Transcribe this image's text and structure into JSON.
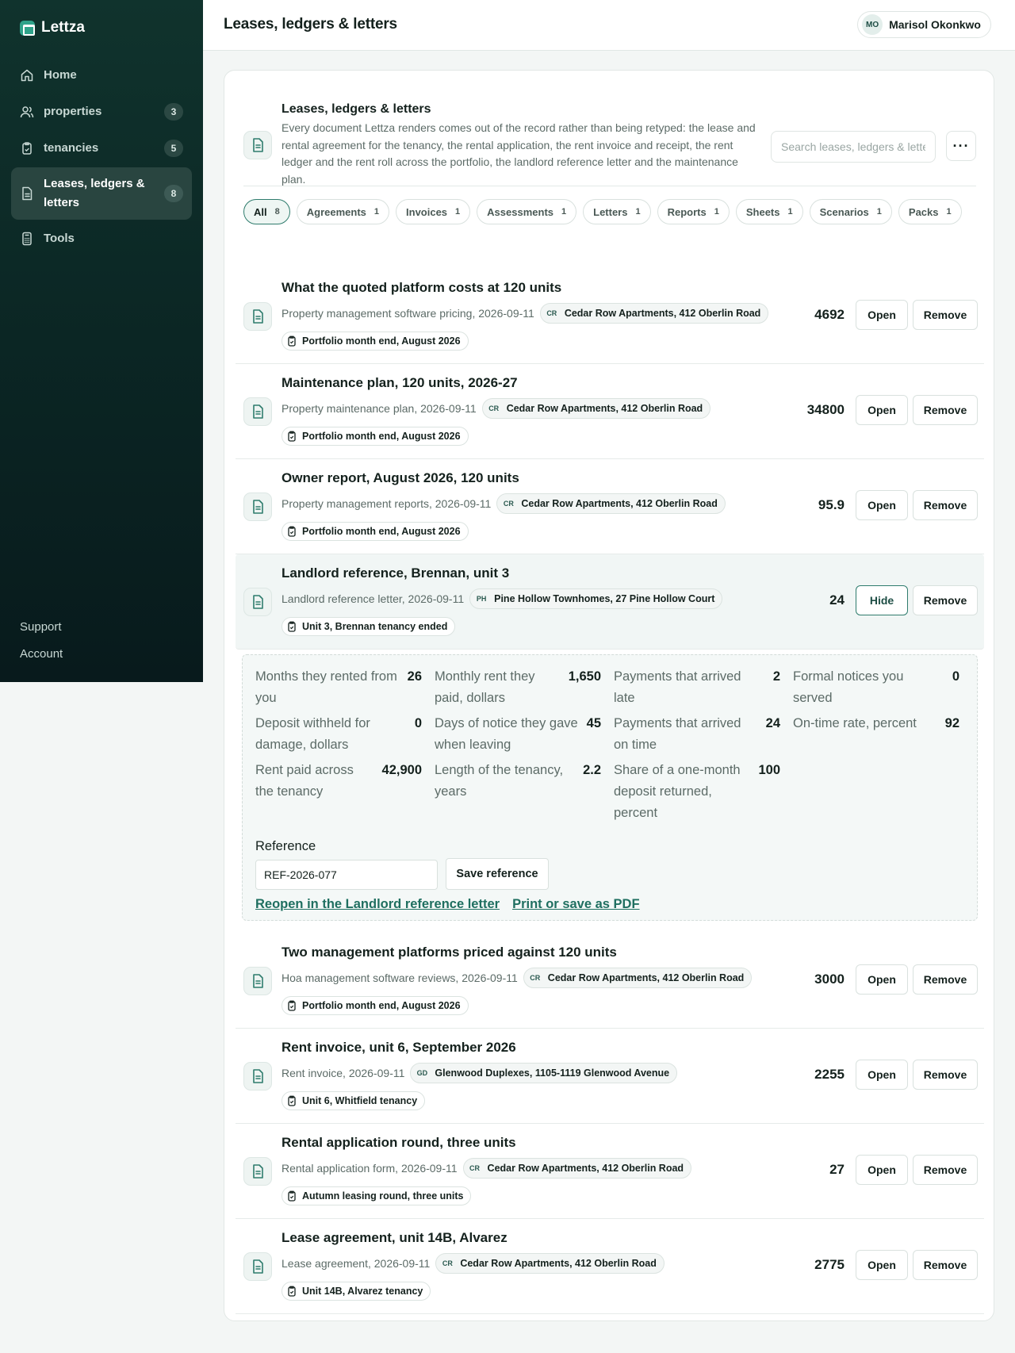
{
  "app": {
    "name": "Lettza"
  },
  "sidebar": {
    "items": [
      {
        "label": "Home",
        "icon": "home-icon",
        "count": null
      },
      {
        "label": "properties",
        "icon": "users-icon",
        "count": "3"
      },
      {
        "label": "tenancies",
        "icon": "clipboard-icon",
        "count": "5"
      },
      {
        "label": "Leases, ledgers & letters",
        "icon": "document-icon",
        "count": "8",
        "active": true
      },
      {
        "label": "Tools",
        "icon": "calculator-icon",
        "count": null
      }
    ],
    "footer": [
      "Support",
      "Account"
    ]
  },
  "header": {
    "title": "Leases, ledgers & letters",
    "user": {
      "initials": "MO",
      "name": "Marisol Okonkwo"
    }
  },
  "intro": {
    "title": "Leases, ledgers & letters",
    "description": "Every document Lettza renders comes out of the record rather than being retyped: the lease and rental agreement for the tenancy, the rental application, the rent invoice and receipt, the rent ledger and the rent roll across the portfolio, the landlord reference letter and the maintenance plan.",
    "search_placeholder": "Search leases, ledgers & letters",
    "more_label": "···"
  },
  "filters": [
    {
      "label": "All",
      "count": "8",
      "active": true
    },
    {
      "label": "Agreements",
      "count": "1"
    },
    {
      "label": "Invoices",
      "count": "1"
    },
    {
      "label": "Assessments",
      "count": "1"
    },
    {
      "label": "Letters",
      "count": "1"
    },
    {
      "label": "Reports",
      "count": "1"
    },
    {
      "label": "Sheets",
      "count": "1"
    },
    {
      "label": "Scenarios",
      "count": "1"
    },
    {
      "label": "Packs",
      "count": "1"
    }
  ],
  "documents": [
    {
      "title": "What the quoted platform costs at 120 units",
      "meta": "Property management software pricing, 2026-09-11",
      "prop_abbr": "CR",
      "property": "Cedar Row Apartments, 412 Oberlin Road",
      "tag": "Portfolio month end, August 2026",
      "value": "4692",
      "open_label": "Open",
      "remove_label": "Remove"
    },
    {
      "title": "Maintenance plan, 120 units, 2026-27",
      "meta": "Property maintenance plan, 2026-09-11",
      "prop_abbr": "CR",
      "property": "Cedar Row Apartments, 412 Oberlin Road",
      "tag": "Portfolio month end, August 2026",
      "value": "34800",
      "open_label": "Open",
      "remove_label": "Remove"
    },
    {
      "title": "Owner report, August 2026, 120 units",
      "meta": "Property management reports, 2026-09-11",
      "prop_abbr": "CR",
      "property": "Cedar Row Apartments, 412 Oberlin Road",
      "tag": "Portfolio month end, August 2026",
      "value": "95.9",
      "open_label": "Open",
      "remove_label": "Remove"
    },
    {
      "title": "Landlord reference, Brennan, unit 3",
      "meta": "Landlord reference letter, 2026-09-11",
      "prop_abbr": "PH",
      "property": "Pine Hollow Townhomes, 27 Pine Hollow Court",
      "tag": "Unit 3, Brennan tenancy ended",
      "value": "24",
      "open_label": "Hide",
      "remove_label": "Remove",
      "expanded": true
    },
    {
      "title": "Two management platforms priced against 120 units",
      "meta": "Hoa management software reviews, 2026-09-11",
      "prop_abbr": "CR",
      "property": "Cedar Row Apartments, 412 Oberlin Road",
      "tag": "Portfolio month end, August 2026",
      "value": "3000",
      "open_label": "Open",
      "remove_label": "Remove"
    },
    {
      "title": "Rent invoice, unit 6, September 2026",
      "meta": "Rent invoice, 2026-09-11",
      "prop_abbr": "GD",
      "property": "Glenwood Duplexes, 1105-1119 Glenwood Avenue",
      "tag": "Unit 6, Whitfield tenancy",
      "value": "2255",
      "open_label": "Open",
      "remove_label": "Remove"
    },
    {
      "title": "Rental application round, three units",
      "meta": "Rental application form, 2026-09-11",
      "prop_abbr": "CR",
      "property": "Cedar Row Apartments, 412 Oberlin Road",
      "tag": "Autumn leasing round, three units",
      "value": "27",
      "open_label": "Open",
      "remove_label": "Remove"
    },
    {
      "title": "Lease agreement, unit 14B, Alvarez",
      "meta": "Lease agreement, 2026-09-11",
      "prop_abbr": "CR",
      "property": "Cedar Row Apartments, 412 Oberlin Road",
      "tag": "Unit 14B, Alvarez tenancy",
      "value": "2775",
      "open_label": "Open",
      "remove_label": "Remove"
    }
  ],
  "detail": {
    "stats": [
      {
        "label": "Months they rented from you",
        "value": "26"
      },
      {
        "label": "Monthly rent they paid, dollars",
        "value": "1,650"
      },
      {
        "label": "Payments that arrived late",
        "value": "2"
      },
      {
        "label": "Formal notices you served",
        "value": "0"
      },
      {
        "label": "Deposit withheld for damage, dollars",
        "value": "0"
      },
      {
        "label": "Days of notice they gave when leaving",
        "value": "45"
      },
      {
        "label": "Payments that arrived on time",
        "value": "24"
      },
      {
        "label": "On-time rate, percent",
        "value": "92"
      },
      {
        "label": "Rent paid across the tenancy",
        "value": "42,900"
      },
      {
        "label": "Length of the tenancy, years",
        "value": "2.2"
      },
      {
        "label": "Share of a one-month deposit returned, percent",
        "value": "100"
      }
    ],
    "reference_label": "Reference",
    "reference_value": "REF-2026-077",
    "save_label": "Save reference",
    "reopen_link": "Reopen in the Landlord reference letter",
    "print_link": "Print or save as PDF"
  },
  "colors": {
    "sidebar_bg": "#0b2624",
    "accent": "#2f7c6d",
    "link": "#1f6f60"
  }
}
